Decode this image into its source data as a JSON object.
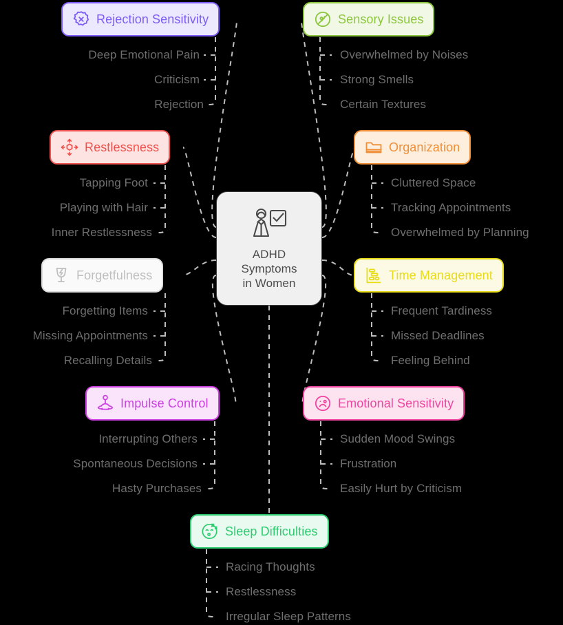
{
  "center": {
    "label": "ADHD\nSymptoms\nin Women",
    "icon": "woman-with-checklist-icon",
    "fill": "#f0f0f0",
    "border": "#3d3d3d",
    "text_color": "#4a4a4a"
  },
  "branches": [
    {
      "id": "rejection-sensitivity",
      "label": "Rejection Sensitivity",
      "icon": "rosette-x-icon",
      "color": "#7c5cf5",
      "fill": "#ece8fd",
      "side": "left",
      "icon_side": "right",
      "leaves": [
        "Deep Emotional Pain",
        "Criticism",
        "Rejection"
      ]
    },
    {
      "id": "sensory-issues",
      "label": "Sensory Issues",
      "icon": "no-scent-icon",
      "color": "#8cc63f",
      "fill": "#f2f8e6",
      "side": "right",
      "icon_side": "left",
      "leaves": [
        "Overwhelmed by Noises",
        "Strong Smells",
        "Certain Textures"
      ]
    },
    {
      "id": "restlessness",
      "label": "Restlessness",
      "icon": "move-arrows-icon",
      "color": "#ef5350",
      "fill": "#fde3e1",
      "side": "left",
      "icon_side": "right",
      "leaves": [
        "Tapping Foot",
        "Playing with Hair",
        "Inner Restlessness"
      ]
    },
    {
      "id": "organization",
      "label": "Organization",
      "icon": "folder-icon",
      "color": "#ef8f37",
      "fill": "#fdeedd",
      "side": "right",
      "icon_side": "left",
      "leaves": [
        "Cluttered Space",
        "Tracking Appointments",
        "Overwhelmed by Planning"
      ]
    },
    {
      "id": "forgetfulness",
      "label": "Forgetfulness",
      "icon": "broken-glass-icon",
      "color": "#dcdcdc",
      "fill": "#fafafa",
      "text_color": "#bfbfbf",
      "side": "left",
      "icon_side": "right",
      "leaves": [
        "Forgetting Items",
        "Missing Appointments",
        "Recalling Details"
      ]
    },
    {
      "id": "time-management",
      "label": "Time Management",
      "icon": "gantt-chart-icon",
      "color": "#e8dc18",
      "fill": "#fcfae4",
      "side": "right",
      "icon_side": "left",
      "leaves": [
        "Frequent Tardiness",
        "Missed Deadlines",
        "Feeling Behind"
      ]
    },
    {
      "id": "impulse-control",
      "label": "Impulse Control",
      "icon": "meditation-icon",
      "color": "#cc3fe0",
      "fill": "#f9e4fc",
      "side": "left",
      "icon_side": "right",
      "leaves": [
        "Interrupting Others",
        "Spontaneous Decisions",
        "Hasty Purchases"
      ]
    },
    {
      "id": "emotional-sensitivity",
      "label": "Emotional Sensitivity",
      "icon": "sad-face-icon",
      "color": "#ef45a0",
      "fill": "#fde2f0",
      "side": "right",
      "icon_side": "left",
      "leaves": [
        "Sudden Mood Swings",
        "Frustration",
        "Easily Hurt by Criticism"
      ]
    },
    {
      "id": "sleep-difficulties",
      "label": "Sleep Difficulties",
      "icon": "sleeping-face-icon",
      "color": "#2ecc71",
      "fill": "#e9faf0",
      "side": "bottom",
      "icon_side": "left",
      "leaves": [
        "Racing Thoughts",
        "Restlessness",
        "Irregular Sleep Patterns"
      ]
    }
  ],
  "style": {
    "leaf_color": "#6e6e6e",
    "edge_color": "#bdbdbd",
    "background": "#000000"
  }
}
